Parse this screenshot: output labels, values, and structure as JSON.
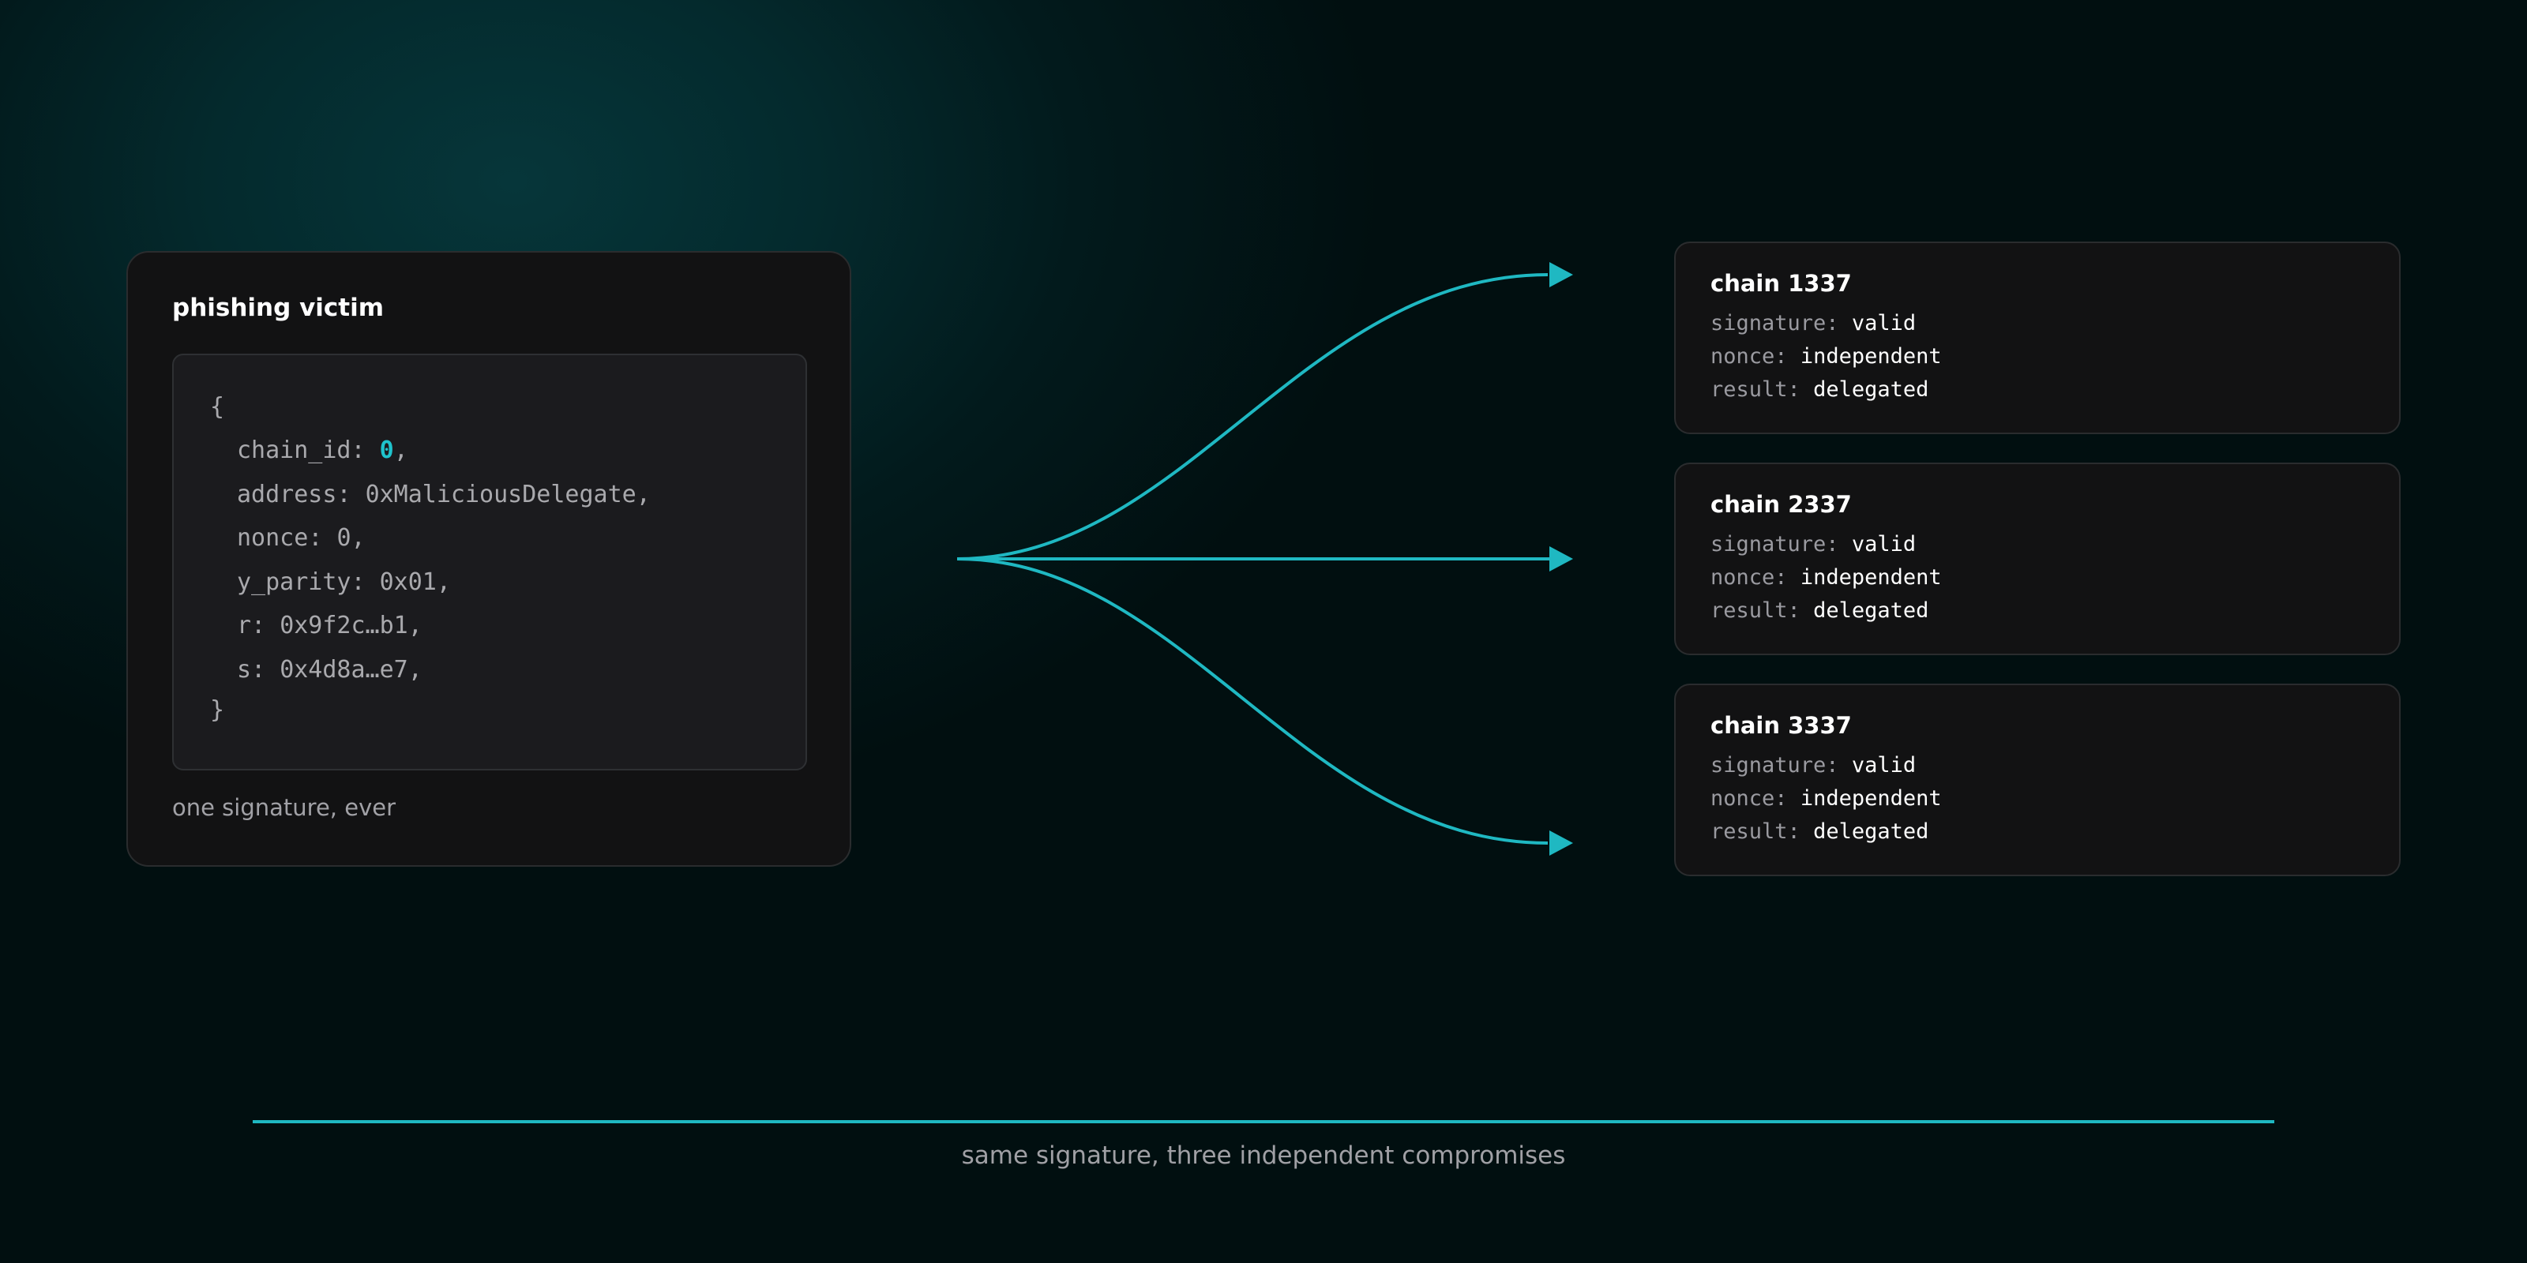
{
  "victim": {
    "title": "phishing victim",
    "caption": "one signature, ever",
    "code": {
      "open": "{",
      "close": "}",
      "fields": [
        {
          "key": "chain_id",
          "value": "0",
          "highlight": true
        },
        {
          "key": "address",
          "value": "0xMaliciousDelegate",
          "highlight": false
        },
        {
          "key": "nonce",
          "value": "0",
          "highlight": false
        },
        {
          "key": "y_parity",
          "value": "0x01",
          "highlight": false
        },
        {
          "key": "r",
          "value": "0x9f2c…b1",
          "highlight": false
        },
        {
          "key": "s",
          "value": "0x4d8a…e7",
          "highlight": false
        }
      ]
    }
  },
  "chains": [
    {
      "title": "chain 1337",
      "rows": [
        {
          "label": "signature:",
          "value": "valid"
        },
        {
          "label": "nonce:",
          "value": "independent"
        },
        {
          "label": "result:",
          "value": "delegated"
        }
      ]
    },
    {
      "title": "chain 2337",
      "rows": [
        {
          "label": "signature:",
          "value": "valid"
        },
        {
          "label": "nonce:",
          "value": "independent"
        },
        {
          "label": "result:",
          "value": "delegated"
        }
      ]
    },
    {
      "title": "chain 3337",
      "rows": [
        {
          "label": "signature:",
          "value": "valid"
        },
        {
          "label": "nonce:",
          "value": "independent"
        },
        {
          "label": "result:",
          "value": "delegated"
        }
      ]
    }
  ],
  "footer": {
    "caption": "same signature, three independent compromises"
  },
  "colors": {
    "accent": "#1fb8c2",
    "highlight": "#1fc3cc",
    "card": "#121213"
  }
}
